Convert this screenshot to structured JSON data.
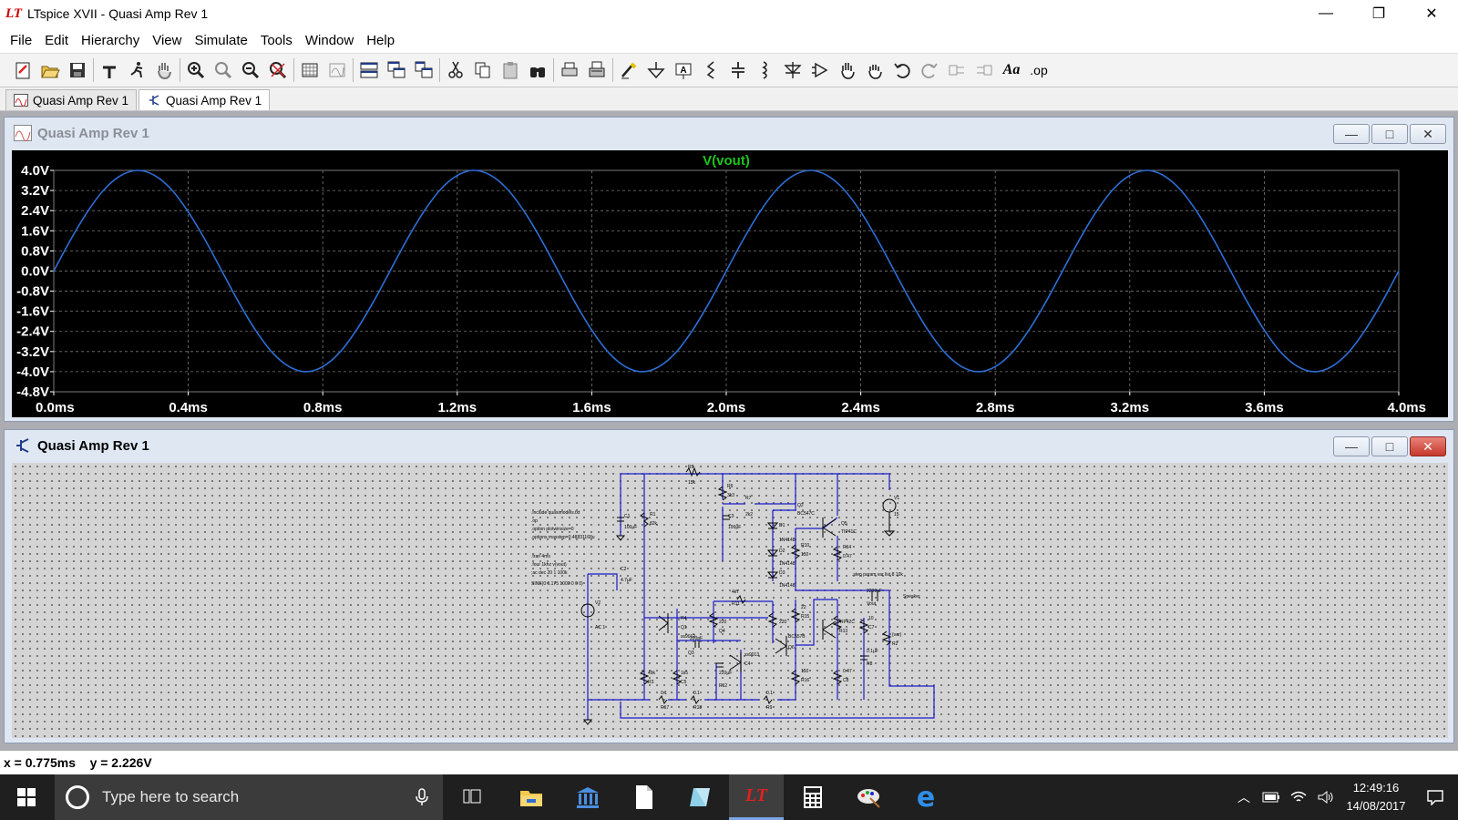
{
  "app": {
    "title": "LTspice XVII - Quasi Amp Rev 1",
    "logo_glyph": "LT"
  },
  "window_controls": {
    "minimize": "—",
    "maximize": "❐",
    "close": "✕"
  },
  "menu": [
    "File",
    "Edit",
    "Hierarchy",
    "View",
    "Simulate",
    "Tools",
    "Window",
    "Help"
  ],
  "toolbar_icons": [
    "new-schematic-icon",
    "open-icon",
    "save-icon",
    "control-panel-icon",
    "run-icon",
    "halt-icon",
    "zoom-in-icon",
    "zoom-rubberband-icon",
    "zoom-out-icon",
    "zoom-full-icon",
    "autorange-icon",
    "edit-plot-icon",
    "tile-horizontal-icon",
    "cascade-icon",
    "tile-vertical-icon",
    "cut-icon",
    "copy-icon",
    "paste-icon",
    "find-icon",
    "print-icon",
    "print-setup-icon",
    "wire-icon",
    "ground-icon",
    "label-net-icon",
    "resistor-icon",
    "capacitor-icon",
    "inductor-icon",
    "diode-icon",
    "component-icon",
    "move-icon",
    "drag-icon",
    "undo-icon",
    "redo-icon",
    "rotate-icon",
    "mirror-icon",
    "text-icon",
    "spice-directive-icon"
  ],
  "toolbar_labels": {
    "text": "Aa",
    "spice_directive": ".op"
  },
  "doc_tabs": [
    {
      "label": "Quasi Amp Rev 1",
      "kind": "waveform",
      "active": false
    },
    {
      "label": "Quasi Amp Rev 1",
      "kind": "schematic",
      "active": true
    }
  ],
  "plot_window": {
    "title": "Quasi Amp Rev 1",
    "controls": {
      "minimize": "—",
      "maximize": "□",
      "close": "✕"
    }
  },
  "schematic_window": {
    "title": "Quasi Amp Rev 1",
    "controls": {
      "minimize": "—",
      "maximize": "□",
      "close": "✕"
    },
    "directives": [
      ".include quasimodels.txt",
      ".op",
      ".option plotwinsize=0",
      ".options maxstep=0.48831168u",
      ".tran 4ms",
      ".four 1khz v(vout)",
      ";ac dec 20 1 100k",
      "SINE(0 0.175 1000 0 0 0)"
    ],
    "step_directive": ".step param var list 8 10k",
    "labels": [
      "R5",
      "15k",
      "R6",
      "3k3",
      "R7",
      "2k2",
      "C1",
      "100µF",
      "R1",
      "82k",
      "C3",
      "100µF",
      "Q2",
      "BC547C",
      "Q5",
      "TIP41C",
      "D1",
      "1N4148",
      "D2",
      "1N4148",
      "D3",
      "1N4148",
      "R10",
      "150",
      "R14",
      "0.47",
      "V1",
      "15",
      "C2",
      "4.7µF",
      "V2",
      "AC 1",
      "Q1",
      "ss9012",
      "R4",
      "4k7",
      "R11",
      "22",
      "R15",
      "220",
      "Q4",
      "BC557B",
      "Q6",
      "TIP42C",
      "R13",
      "10",
      "C7",
      "2200µF",
      "Vout",
      "Speaker",
      "{var}",
      "R2",
      "49k",
      "R3",
      "1k5",
      "C5",
      "220pF",
      "Q3",
      "ss9013",
      "C4",
      "220µF",
      "R12",
      "150",
      "R16",
      "0.47",
      "C8",
      "0.1µF",
      "R8",
      "0.1",
      "R17",
      "0.1",
      "R18",
      "0.1",
      "R9",
      "220"
    ]
  },
  "chart_data": {
    "type": "line",
    "title": "V(vout)",
    "xlabel": "",
    "ylabel": "",
    "xlim": [
      0,
      4.0
    ],
    "ylim": [
      -4.8,
      4.0
    ],
    "x_unit": "ms",
    "x_ticks": [
      "0.0ms",
      "0.4ms",
      "0.8ms",
      "1.2ms",
      "1.6ms",
      "2.0ms",
      "2.4ms",
      "2.8ms",
      "3.2ms",
      "3.6ms",
      "4.0ms"
    ],
    "y_ticks": [
      "4.0V",
      "3.2V",
      "2.4V",
      "1.6V",
      "0.8V",
      "0.0V",
      "-0.8V",
      "-1.6V",
      "-2.4V",
      "-3.2V",
      "-4.0V",
      "-4.8V"
    ],
    "y_tick_values": [
      4.0,
      3.2,
      2.4,
      1.6,
      0.8,
      0.0,
      -0.8,
      -1.6,
      -2.4,
      -3.2,
      -4.0,
      -4.8
    ],
    "grid": true,
    "series": [
      {
        "name": "V(vout)",
        "color": "#2d6fd6",
        "x": [
          0.0,
          0.05,
          0.1,
          0.15,
          0.2,
          0.25,
          0.3,
          0.35,
          0.4,
          0.45,
          0.5,
          0.55,
          0.6,
          0.65,
          0.7,
          0.75,
          0.8,
          0.85,
          0.9,
          0.95,
          1.0,
          1.05,
          1.1,
          1.15,
          1.2,
          1.25,
          1.3,
          1.35,
          1.4,
          1.45,
          1.5,
          1.55,
          1.6,
          1.65,
          1.7,
          1.75,
          1.8,
          1.85,
          1.9,
          1.95,
          2.0,
          2.05,
          2.1,
          2.15,
          2.2,
          2.25,
          2.3,
          2.35,
          2.4,
          2.45,
          2.5,
          2.55,
          2.6,
          2.65,
          2.7,
          2.75,
          2.8,
          2.85,
          2.9,
          2.95,
          3.0,
          3.05,
          3.1,
          3.15,
          3.2,
          3.25,
          3.3,
          3.35,
          3.4,
          3.45,
          3.5,
          3.55,
          3.6,
          3.65,
          3.7,
          3.75,
          3.8,
          3.85,
          3.9,
          3.95,
          4.0
        ],
        "y": [
          0.0,
          1.24,
          2.35,
          3.24,
          3.8,
          4.0,
          3.8,
          3.24,
          2.35,
          1.24,
          0.0,
          -1.24,
          -2.35,
          -3.24,
          -3.8,
          -4.0,
          -3.8,
          -3.24,
          -2.35,
          -1.24,
          0.0,
          1.24,
          2.35,
          3.24,
          3.8,
          4.0,
          3.8,
          3.24,
          2.35,
          1.24,
          0.0,
          -1.24,
          -2.35,
          -3.24,
          -3.8,
          -4.0,
          -3.8,
          -3.24,
          -2.35,
          -1.24,
          0.0,
          1.24,
          2.35,
          3.24,
          3.8,
          4.0,
          3.8,
          3.24,
          2.35,
          1.24,
          0.0,
          -1.24,
          -2.35,
          -3.24,
          -3.8,
          -4.0,
          -3.8,
          -3.24,
          -2.35,
          -1.24,
          0.0,
          1.24,
          2.35,
          3.24,
          3.8,
          4.0,
          3.8,
          3.24,
          2.35,
          1.24,
          0.0,
          -1.24,
          -2.35,
          -3.24,
          -3.8,
          -4.0,
          -3.8,
          -3.24,
          -2.35,
          -1.24,
          0.0
        ]
      }
    ],
    "colors": {
      "background": "#000000",
      "grid": "#7a7a7a",
      "tick_text": "#ffffff",
      "title": "#19c619"
    }
  },
  "status": {
    "cursor": "x = 0.775ms    y = 2.226V"
  },
  "taskbar": {
    "search_placeholder": "Type here to search",
    "apps": [
      "task-view-icon",
      "file-explorer-icon",
      "library-icon",
      "document-icon",
      "notepad-icon",
      "ltspice-icon",
      "calculator-icon",
      "paint-icon",
      "edge-icon"
    ],
    "active_app": "ltspice-icon",
    "clock_time": "12:49:16",
    "clock_date": "14/08/2017"
  }
}
